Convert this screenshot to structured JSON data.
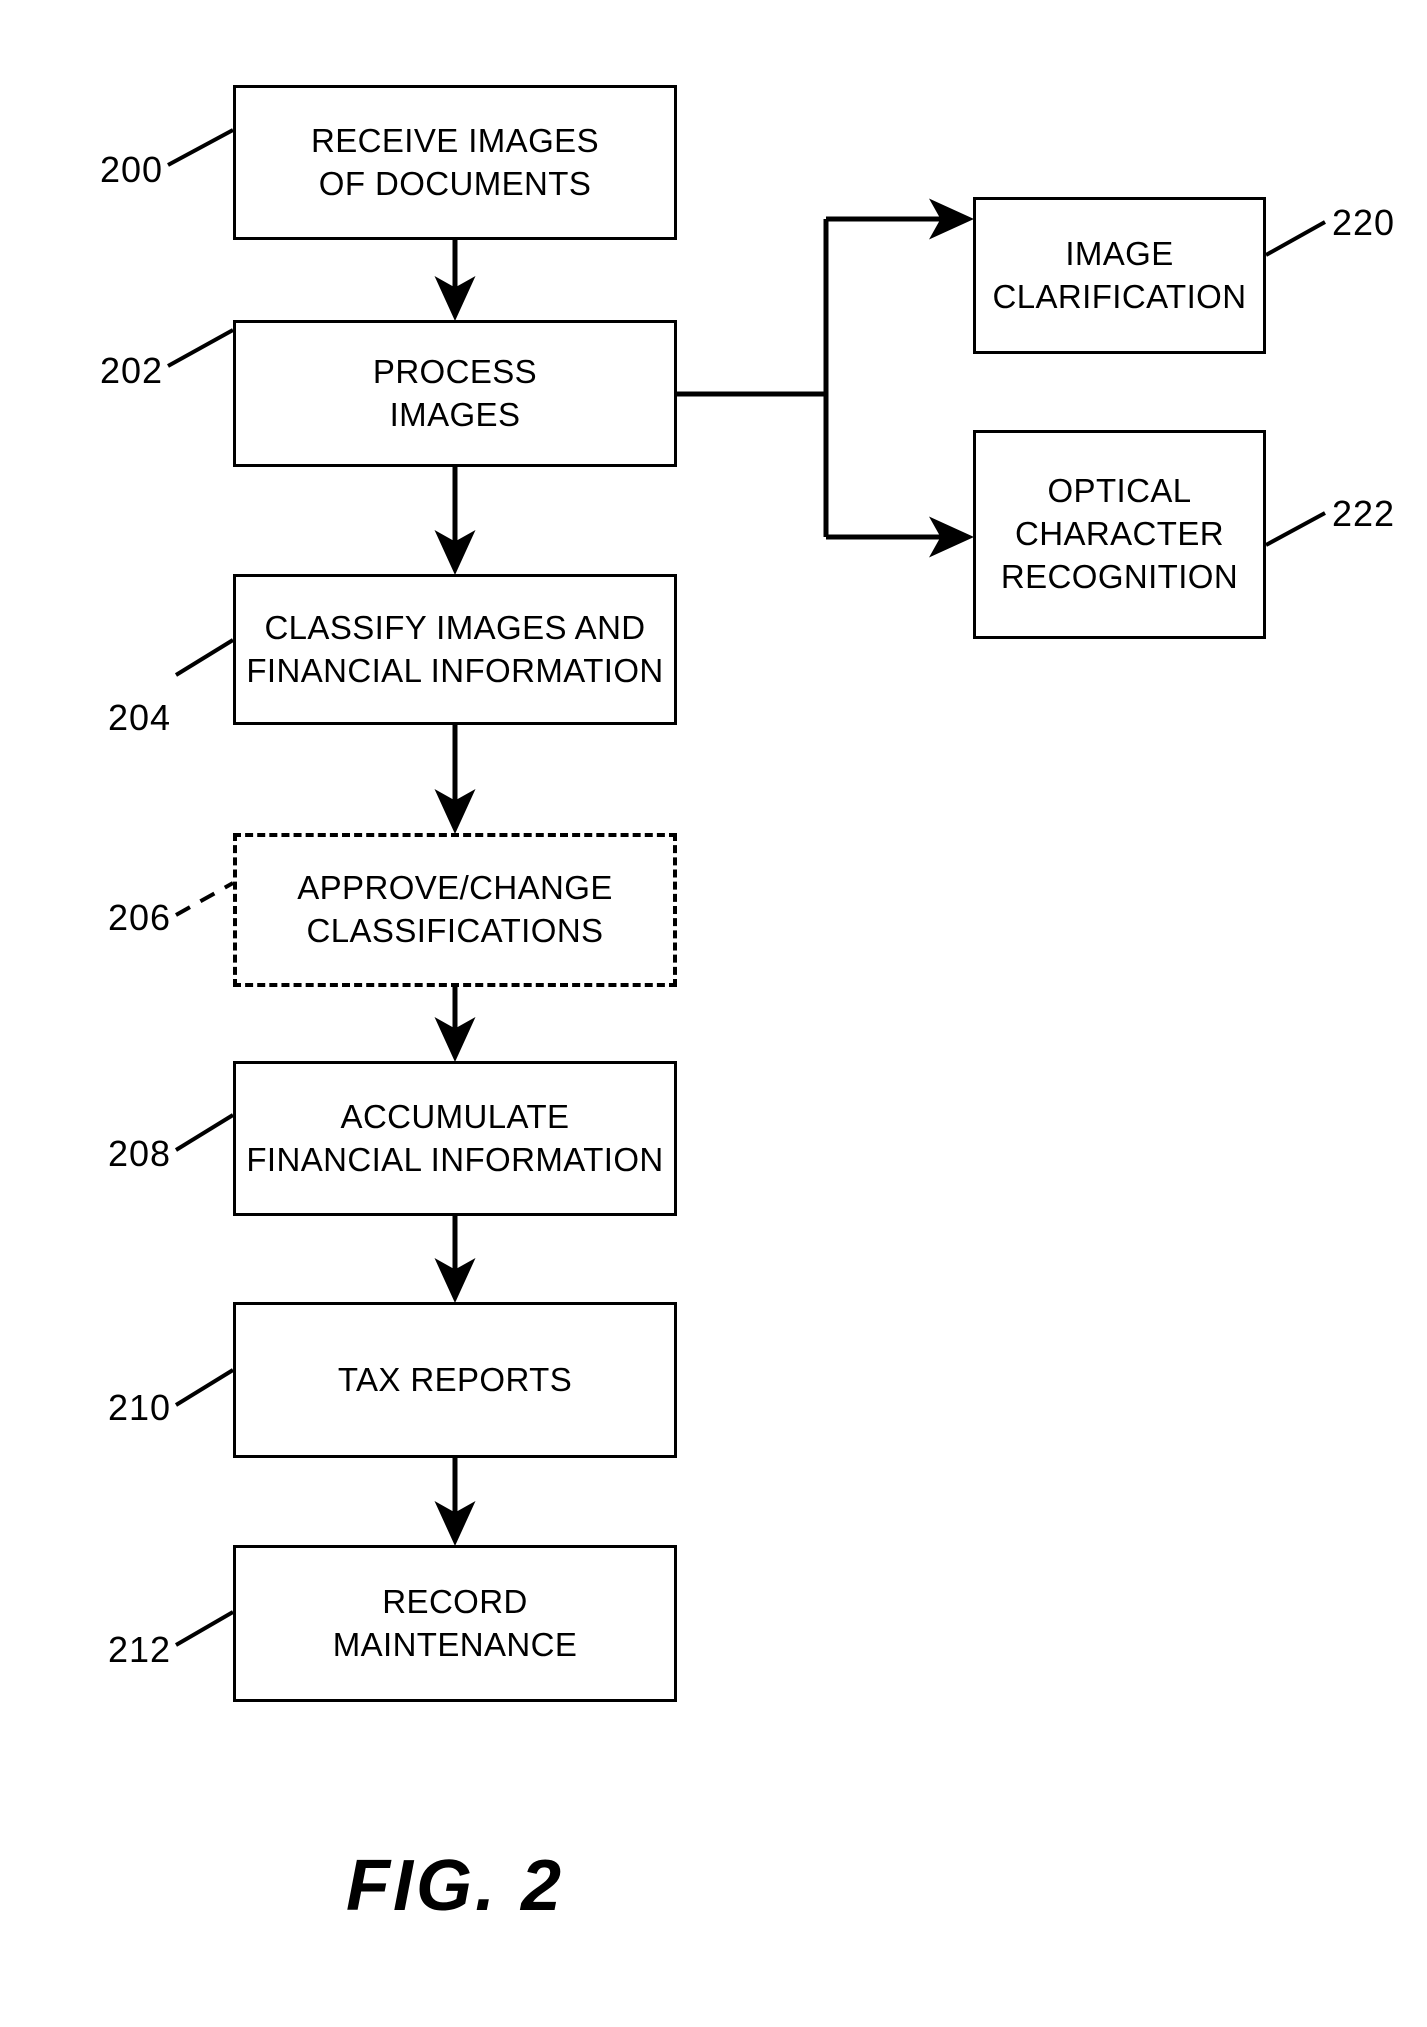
{
  "figure": {
    "caption": "FIG. 2",
    "stroke_color": "#000000",
    "background_color": "#ffffff"
  },
  "flow": {
    "main_steps": [
      {
        "ref": "200",
        "lines": [
          "RECEIVE IMAGES",
          "OF DOCUMENTS"
        ],
        "border": "solid"
      },
      {
        "ref": "202",
        "lines": [
          "PROCESS",
          "IMAGES"
        ],
        "border": "solid"
      },
      {
        "ref": "204",
        "lines": [
          "CLASSIFY IMAGES AND",
          "FINANCIAL INFORMATION"
        ],
        "border": "solid"
      },
      {
        "ref": "206",
        "lines": [
          "APPROVE/CHANGE",
          "CLASSIFICATIONS"
        ],
        "border": "dashed"
      },
      {
        "ref": "208",
        "lines": [
          "ACCUMULATE",
          "FINANCIAL INFORMATION"
        ],
        "border": "solid"
      },
      {
        "ref": "210",
        "lines": [
          "TAX REPORTS"
        ],
        "border": "solid"
      },
      {
        "ref": "212",
        "lines": [
          "RECORD",
          "MAINTENANCE"
        ],
        "border": "solid"
      }
    ],
    "branch_steps": [
      {
        "ref": "220",
        "lines": [
          "IMAGE",
          "CLARIFICATION"
        ],
        "border": "solid"
      },
      {
        "ref": "222",
        "lines": [
          "OPTICAL",
          "CHARACTER",
          "RECOGNITION"
        ],
        "border": "solid"
      }
    ]
  }
}
